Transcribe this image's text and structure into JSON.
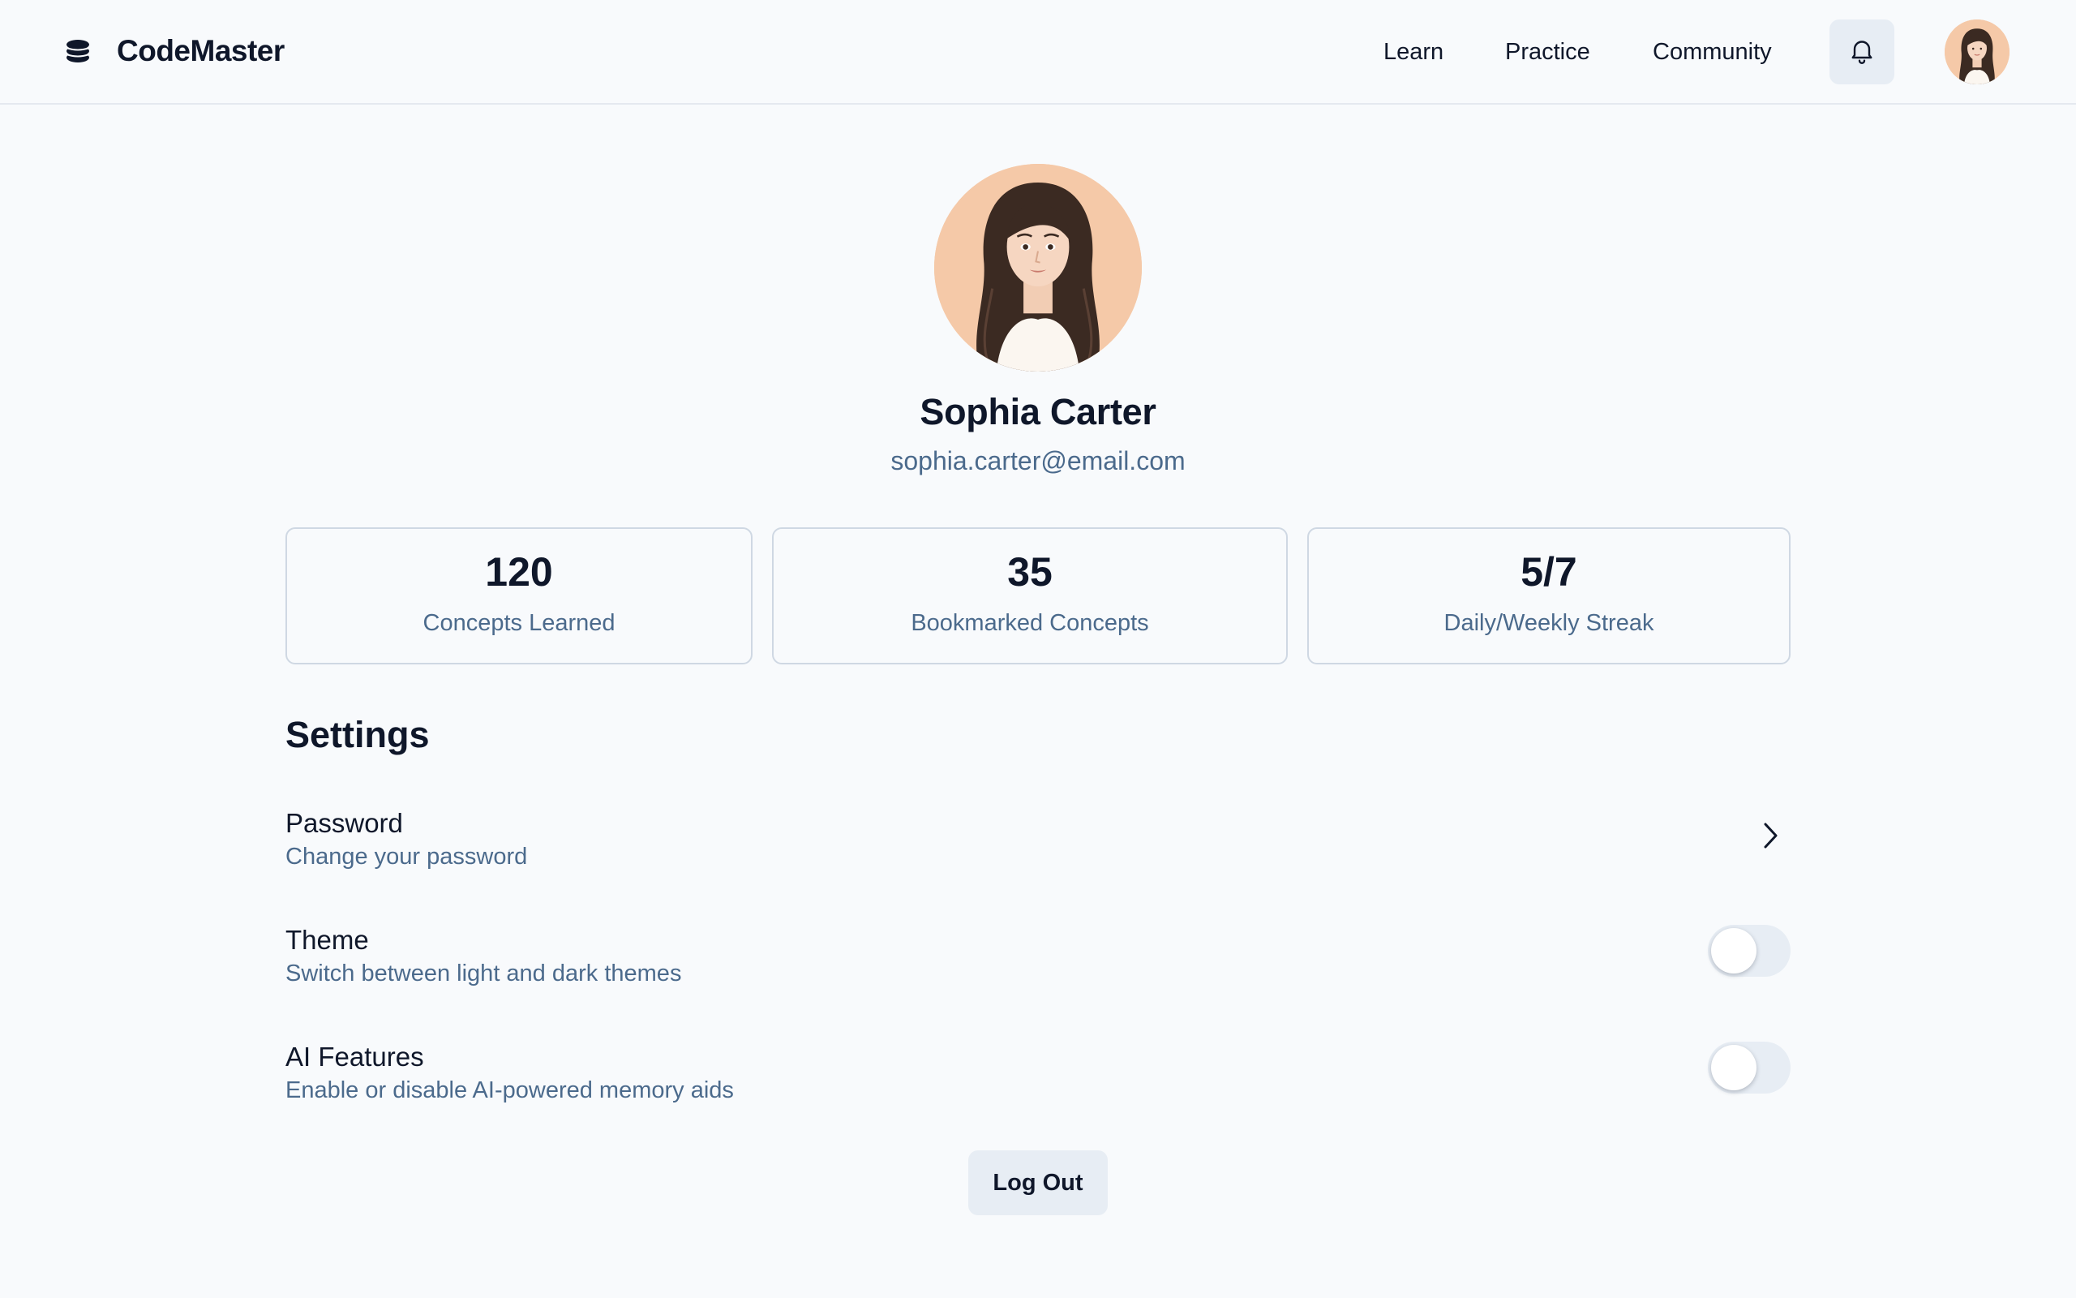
{
  "app": {
    "name": "CodeMaster",
    "logo_icon": "stack-icon"
  },
  "nav": {
    "items": [
      "Learn",
      "Practice",
      "Community"
    ]
  },
  "header": {
    "notifications_icon": "bell-icon",
    "avatar": "user-avatar"
  },
  "profile": {
    "name": "Sophia Carter",
    "email": "sophia.carter@email.com"
  },
  "stats": [
    {
      "value": "120",
      "label": "Concepts Learned"
    },
    {
      "value": "35",
      "label": "Bookmarked Concepts"
    },
    {
      "value": "5/7",
      "label": "Daily/Weekly Streak"
    }
  ],
  "settings": {
    "title": "Settings",
    "items": [
      {
        "title": "Password",
        "description": "Change your password",
        "control": "chevron-right-icon"
      },
      {
        "title": "Theme",
        "description": "Switch between light and dark themes",
        "control": "toggle",
        "enabled": false
      },
      {
        "title": "AI Features",
        "description": "Enable or disable AI-powered memory aids",
        "control": "toggle",
        "enabled": false
      }
    ]
  },
  "actions": {
    "logout_label": "Log Out"
  },
  "colors": {
    "background": "#f8fafc",
    "text_primary": "#0f172a",
    "text_secondary": "#4b6a8c",
    "button_bg": "#e7edf4",
    "card_border": "#cfd8e3",
    "avatar_bg": "#f5c9a8"
  }
}
